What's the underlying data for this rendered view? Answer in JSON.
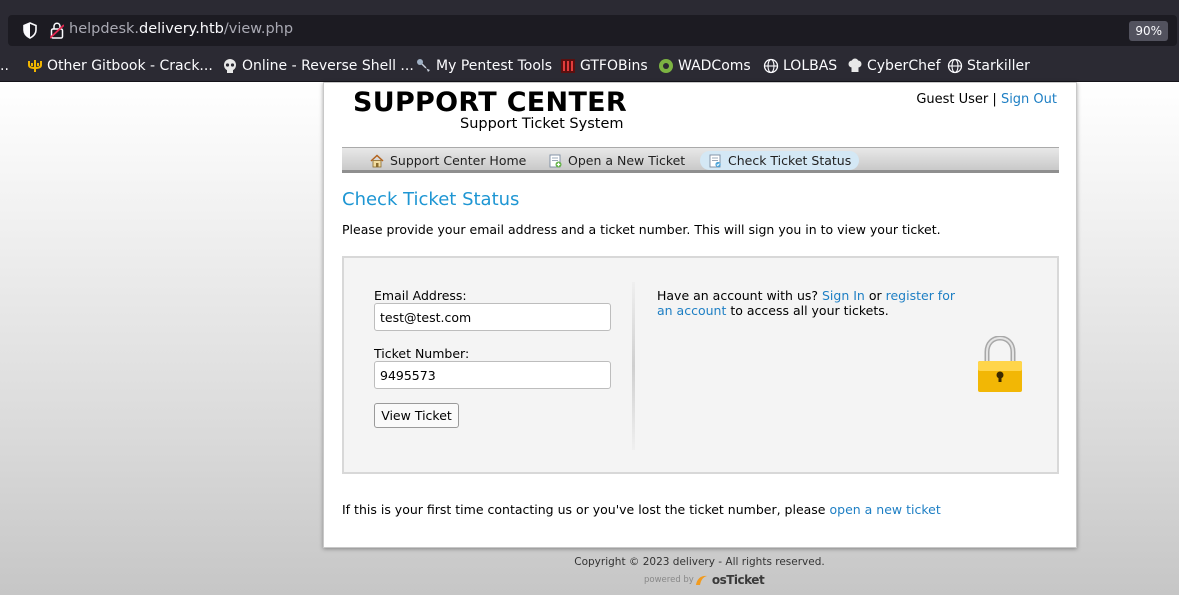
{
  "browser": {
    "url_host_prefix": "helpdesk.",
    "url_host_domain": "delivery.htb",
    "url_path": "/view.php",
    "zoom": "90%",
    "bookmarks": [
      {
        "label": "..",
        "icon": "ellipsis-icon"
      },
      {
        "label": "Other Gitbook - Crack...",
        "icon": "trident-icon"
      },
      {
        "label": "Online - Reverse Shell ...",
        "icon": "skull-icon"
      },
      {
        "label": "My Pentest Tools",
        "icon": "tool-icon"
      },
      {
        "label": "GTFOBins",
        "icon": "gtfobins-icon"
      },
      {
        "label": "WADComs",
        "icon": "wadcoms-icon"
      },
      {
        "label": "LOLBAS",
        "icon": "globe-icon"
      },
      {
        "label": "CyberChef",
        "icon": "chef-hat-icon"
      },
      {
        "label": "Starkiller",
        "icon": "globe-icon"
      }
    ]
  },
  "header": {
    "logo_title": "SUPPORT CENTER",
    "logo_subtitle": "Support Ticket System",
    "user_name": "Guest User",
    "separator": "|",
    "sign_out": "Sign Out"
  },
  "nav": {
    "items": [
      {
        "label": "Support Center Home",
        "icon": "home-icon"
      },
      {
        "label": "Open a New Ticket",
        "icon": "new-ticket-icon"
      },
      {
        "label": "Check Ticket Status",
        "icon": "ticket-status-icon",
        "active": true
      }
    ]
  },
  "main": {
    "title": "Check Ticket Status",
    "intro": "Please provide your email address and a ticket number. This will sign you in to view your ticket.",
    "form": {
      "email_label": "Email Address:",
      "email_value": "test@test.com",
      "ticket_label": "Ticket Number:",
      "ticket_value": "9495573",
      "submit_label": "View Ticket"
    },
    "account": {
      "prefix": "Have an account with us?",
      "sign_in": "Sign In",
      "or": "or",
      "register": "register for an account",
      "suffix": "to access all your tickets."
    },
    "footnote": {
      "text": "If this is your first time contacting us or you've lost the ticket number, please",
      "link": "open a new ticket"
    }
  },
  "footer": {
    "copyright": "Copyright © 2023 delivery - All rights reserved.",
    "powered_by": "powered by",
    "brand": "osTicket"
  },
  "colors": {
    "link": "#1e7fc4",
    "title": "#1e96d3",
    "browser_chrome": "#2b2a33"
  }
}
